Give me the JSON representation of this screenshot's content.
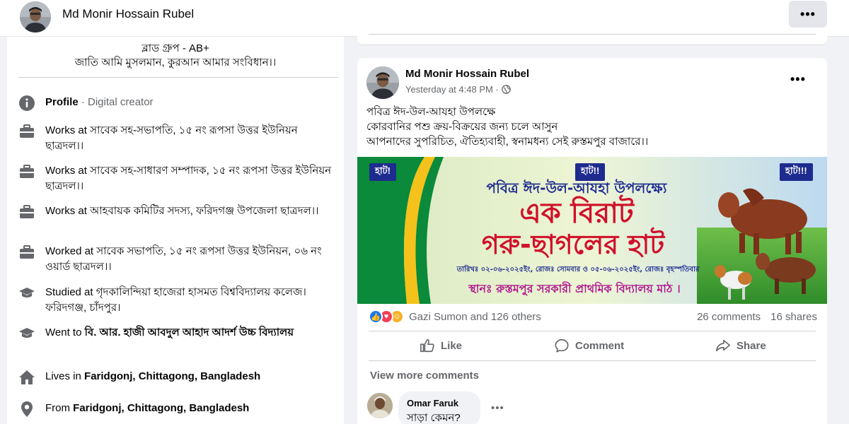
{
  "header": {
    "profile_name": "Md Monir Hossain Rubel",
    "more_label": "•••"
  },
  "intro": {
    "bio_line1": "ব্লাড গ্রুপ - AB+",
    "bio_line2": "জাতি আমি মুসলমান, কুরআন আমার সংবিধান।।",
    "items": [
      {
        "icon": "info-icon",
        "prefix": "Profile",
        "text": " · Digital creator"
      },
      {
        "icon": "briefcase-icon",
        "prefix": "Works at ",
        "text": "সাবেক সহ-সভাপতি, ১৫ নং রূপসা উত্তর ইউনিয়ন ছাত্রদল।।"
      },
      {
        "icon": "briefcase-icon",
        "prefix": "Works at ",
        "text": "সাবেক সহ-সাধারণ সম্পাদক, ১৫ নং রূপসা উত্তর ইউনিয়ন ছাত্রদল।।"
      },
      {
        "icon": "briefcase-icon",
        "prefix": "Works at ",
        "text": "আহবায়ক কমিটির সদস্য, ফরিদগঞ্জ উপজেলা ছাত্রদল।।"
      },
      {
        "icon": "briefcase-icon",
        "prefix": "Worked at ",
        "text": "সাবেক সভাপতি, ১৫ নং রূপসা উত্তর ইউনিয়ন, ০৬ নং ওয়ার্ড ছাত্রদল।।"
      },
      {
        "icon": "graduation-cap-icon",
        "prefix": "Studied at ",
        "text": "গৃদকালিন্দিয়া হাজেরা হাসমত বিশ্ববিদ্যালয় কলেজ।ফরিদগঞ্জ, চাঁদপুর।"
      },
      {
        "icon": "graduation-cap-icon",
        "prefix": "Went to ",
        "bold": "বি. আর. হাজী আবদুল আহাদ আদর্শ উচ্চ বিদ্যালয়"
      },
      {
        "icon": "home-icon",
        "prefix": "Lives in ",
        "bold": "Faridgonj, Chittagong, Bangladesh"
      },
      {
        "icon": "location-pin-icon",
        "prefix": "From ",
        "bold": "Faridgonj, Chittagong, Bangladesh"
      }
    ]
  },
  "post": {
    "author": "Md Monir Hossain Rubel",
    "time": "Yesterday at 4:48 PM ·",
    "more_label": "•••",
    "text_line1": "পবিত্র ঈদ-উল-আযহা উপলক্ষে",
    "text_line2": "কোরবানির পশু ক্রয়-বিক্রয়ের জন্য চলে আসুন",
    "text_line3": "আপনাদের সুপরিচিত, ঐতিহ্যবাহী, স্বনামধন্য সেই রুস্তমপুর বাজারে।।",
    "banner": {
      "tag1": "হাট!",
      "tag2": "হাট!!",
      "tag3": "হাট!!!",
      "heading": "পবিত্র ঈদ-উল-আযহা উপলক্ষ্যে",
      "title1": "এক বিরাট",
      "title2": "গরু-ছাগলের হাট",
      "dates": "তারিখঃ ০২-০৬-২০২৫ইং, রোজঃ সোমবার ও ০৫-০৬-২০২৫ইং, রোজঃ বৃহস্পতিবার",
      "venue": "স্থানঃ রুস্তমপুর সরকারী প্রাথমিক বিদ্যালয় মাঠ ।"
    },
    "reactors": "Gazi Sumon and 126 others",
    "comments_count": "26 comments",
    "shares_count": "16 shares",
    "like_label": "Like",
    "comment_label": "Comment",
    "share_label": "Share",
    "view_more": "View more comments",
    "comment": {
      "author": "Omar Faruk",
      "text": "সাড়া কেমন?",
      "more": "•••"
    }
  },
  "colors": {
    "like_blue": "#1877f2",
    "love_red": "#f33e58",
    "care_yellow": "#f7b125",
    "banner_title_red": "#d0112b",
    "banner_heading_blue": "#1e2b8f",
    "banner_green": "#0a8a3a"
  }
}
